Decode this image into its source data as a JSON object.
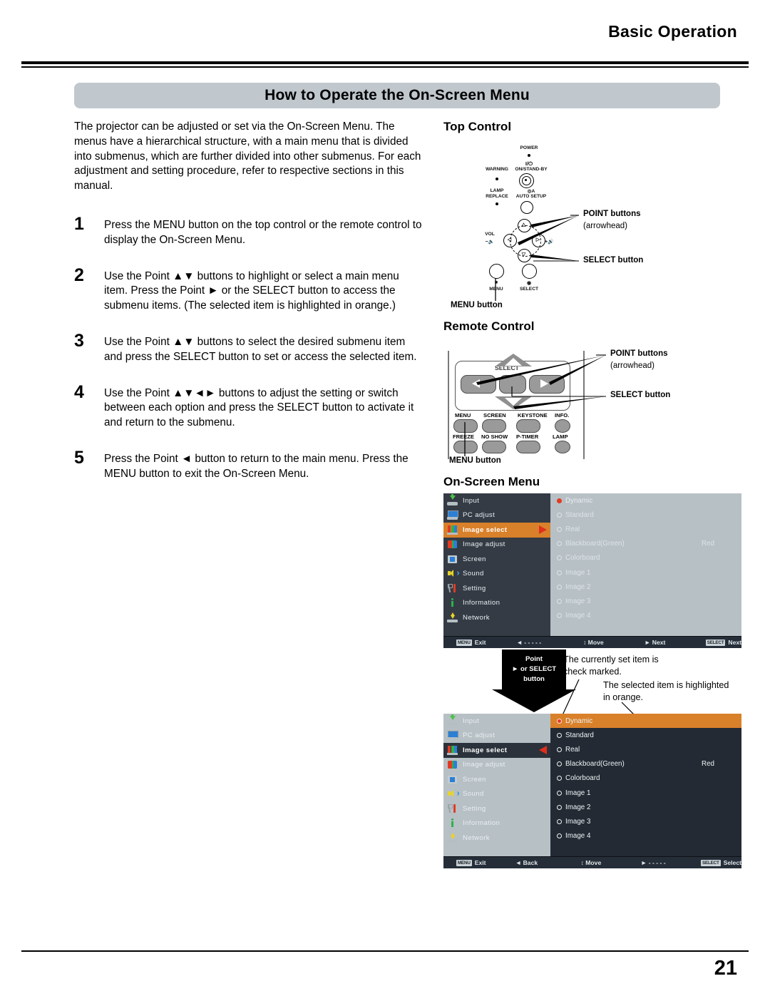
{
  "header": {
    "chapter": "Basic Operation",
    "section_title": "How to Operate the On-Screen Menu"
  },
  "intro": "The projector can be adjusted or set via the On-Screen Menu. The menus have a hierarchical structure, with a main menu that is divided into submenus, which are further divided into other submenus. For each adjustment and setting procedure, refer to respective sections in this manual.",
  "steps": [
    {
      "num": "1",
      "text": "Press the MENU button on the top control or the remote control to display the On-Screen Menu."
    },
    {
      "num": "2",
      "text": "Use the Point ▲▼ buttons to highlight or select a main menu item. Press the Point ► or the SELECT button to access the submenu items. (The selected item is highlighted in orange.)"
    },
    {
      "num": "3",
      "text": "Use the Point ▲▼ buttons to select the desired submenu item and press the SELECT button to set or access the selected item."
    },
    {
      "num": "4",
      "text": "Use the Point ▲▼◄► buttons to adjust the setting or switch between each option and press the SELECT button to activate it and return to the submenu."
    },
    {
      "num": "5",
      "text": "Press the Point ◄ button to return to the main menu. Press the MENU button to exit the On-Screen Menu."
    }
  ],
  "top_control": {
    "heading": "Top Control",
    "labels": {
      "power": "POWER",
      "warning": "WARNING",
      "on_standby_symbol": "I/⏻",
      "on_standby": "ON/STAND-BY",
      "lamp_replace_1": "LAMP",
      "lamp_replace_2": "REPLACE",
      "auto_setup": "AUTO SETUP",
      "vol_1": "VOL",
      "vol_minus": "−",
      "vol_plus": "+",
      "menu": "MENU",
      "select": "SELECT"
    },
    "callouts": {
      "point_buttons": "POINT buttons",
      "point_buttons_sub": "(arrowhead)",
      "select_button": "SELECT button",
      "menu_button": "MENU button"
    }
  },
  "remote_control": {
    "heading": "Remote Control",
    "select_label": "SELECT",
    "buttons_row1": [
      "MENU",
      "SCREEN",
      "KEYSTONE",
      "INFO."
    ],
    "buttons_row2": [
      "FREEZE",
      "NO SHOW",
      "P-TIMER",
      "LAMP"
    ],
    "callouts": {
      "point_buttons": "POINT buttons",
      "point_buttons_sub": "(arrowhead)",
      "select_button": "SELECT button",
      "menu_button": "MENU button"
    }
  },
  "on_screen_menu": {
    "heading": "On-Screen Menu",
    "sidebar_items": [
      {
        "label": "Input",
        "icon": "input-icon"
      },
      {
        "label": "PC adjust",
        "icon": "pc-adjust-icon"
      },
      {
        "label": "Image select",
        "icon": "image-select-icon"
      },
      {
        "label": "Image adjust",
        "icon": "image-adjust-icon"
      },
      {
        "label": "Screen",
        "icon": "screen-icon"
      },
      {
        "label": "Sound",
        "icon": "sound-icon"
      },
      {
        "label": "Setting",
        "icon": "setting-icon"
      },
      {
        "label": "Information",
        "icon": "information-icon"
      },
      {
        "label": "Network",
        "icon": "network-icon"
      }
    ],
    "selected_sidebar_index": 2,
    "options": [
      {
        "label": "Dynamic",
        "checked": true,
        "value": ""
      },
      {
        "label": "Standard",
        "checked": false,
        "value": ""
      },
      {
        "label": "Real",
        "checked": false,
        "value": ""
      },
      {
        "label": "Blackboard(Green)",
        "checked": false,
        "value": "Red"
      },
      {
        "label": "Colorboard",
        "checked": false,
        "value": ""
      },
      {
        "label": "Image 1",
        "checked": false,
        "value": ""
      },
      {
        "label": "Image 2",
        "checked": false,
        "value": ""
      },
      {
        "label": "Image 3",
        "checked": false,
        "value": ""
      },
      {
        "label": "Image 4",
        "checked": false,
        "value": ""
      }
    ],
    "highlighted_option_index": 0,
    "menu1_statusbar": [
      {
        "key": "MENU",
        "label": "Exit"
      },
      {
        "key": "",
        "label": "◄ - - - - -"
      },
      {
        "key": "",
        "label": "↕ Move"
      },
      {
        "key": "",
        "label": "► Next"
      },
      {
        "key": "SELECT",
        "label": "Next"
      }
    ],
    "menu2_statusbar": [
      {
        "key": "MENU",
        "label": "Exit"
      },
      {
        "key": "",
        "label": "◄ Back"
      },
      {
        "key": "",
        "label": "↕ Move"
      },
      {
        "key": "",
        "label": "► - - - - -"
      },
      {
        "key": "SELECT",
        "label": "Select"
      }
    ],
    "transition_callout": {
      "line1": "Point",
      "line2": "► or SELECT",
      "line3": "button"
    },
    "notes": {
      "note1": "The currently set item is check marked.",
      "note2": "The selected item is highlighted in orange."
    }
  },
  "footer": {
    "page_number": "21"
  },
  "colors": {
    "accent_orange": "#d9802a",
    "check_red": "#e23a23",
    "banner_gray": "#c0c7cd",
    "osd_dark": "#232a33"
  }
}
